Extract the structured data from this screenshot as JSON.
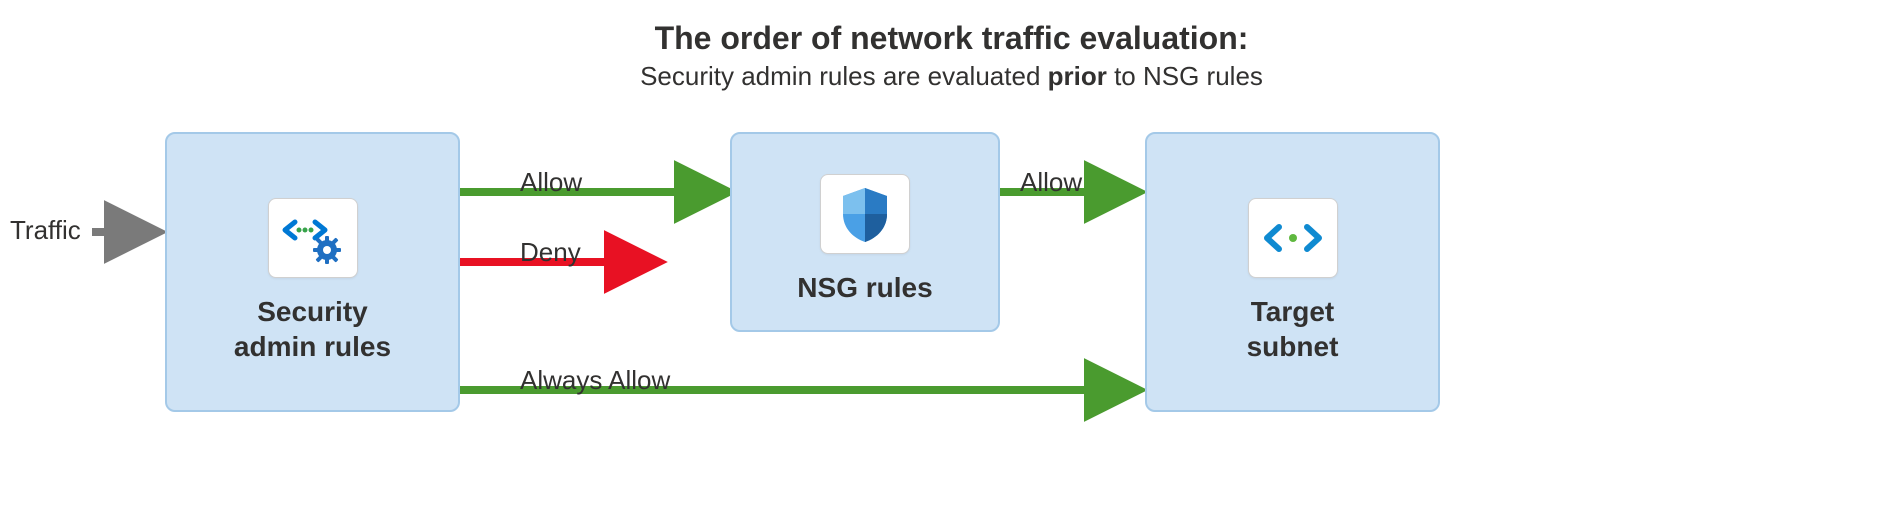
{
  "title": "The order of network traffic evaluation:",
  "subtitle_pre": "Security admin rules are evaluated ",
  "subtitle_bold": "prior",
  "subtitle_post": " to NSG rules",
  "traffic_label": "Traffic",
  "boxes": {
    "security": "Security\nadmin rules",
    "nsg": "NSG rules",
    "target": "Target\nsubnet"
  },
  "arrows": {
    "allow1": "Allow",
    "deny": "Deny",
    "always_allow": "Always Allow",
    "allow2": "Allow"
  },
  "colors": {
    "green": "#4a9b2f",
    "red": "#e81123",
    "grey": "#7a7a7a",
    "boxfill": "#cfe3f5",
    "boxborder": "#a4c9e8"
  }
}
